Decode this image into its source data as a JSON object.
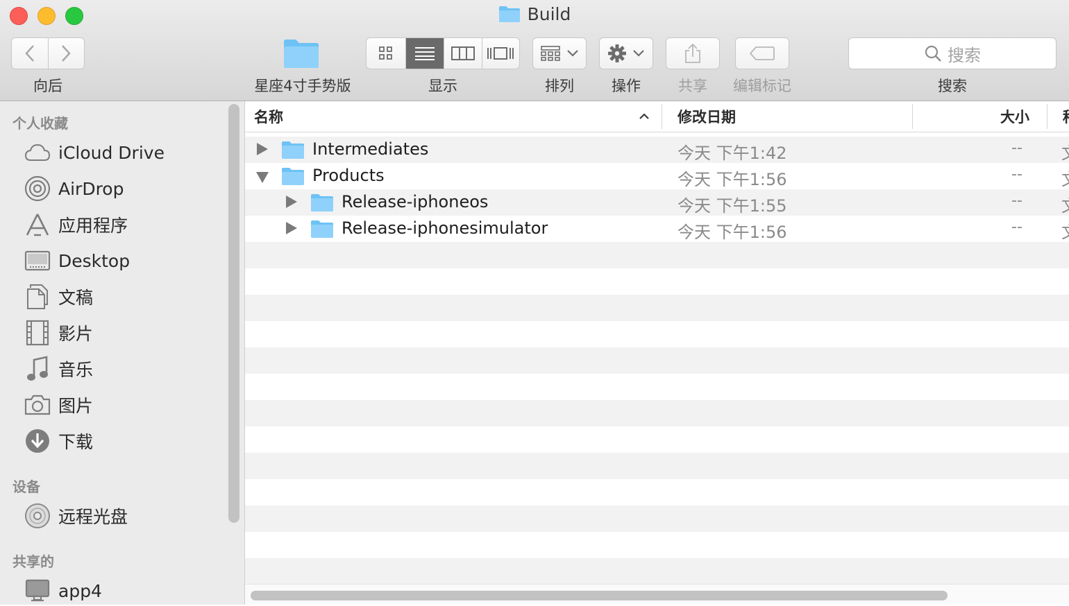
{
  "window": {
    "title": "Build"
  },
  "toolbar": {
    "back_label": "向后",
    "path_label": "星座4寸手势版",
    "view_label": "显示",
    "arrange_label": "排列",
    "action_label": "操作",
    "share_label": "共享",
    "tags_label": "编辑标记",
    "search_label": "搜索",
    "search_placeholder": "搜索",
    "active_view": "list"
  },
  "sidebar": {
    "favorites_header": "个人收藏",
    "favorites": [
      {
        "label": "iCloud Drive",
        "icon": "cloud-icon"
      },
      {
        "label": "AirDrop",
        "icon": "airdrop-icon"
      },
      {
        "label": "应用程序",
        "icon": "applications-icon"
      },
      {
        "label": "Desktop",
        "icon": "desktop-icon"
      },
      {
        "label": "文稿",
        "icon": "documents-icon"
      },
      {
        "label": "影片",
        "icon": "movies-icon"
      },
      {
        "label": "音乐",
        "icon": "music-icon"
      },
      {
        "label": "图片",
        "icon": "camera-icon"
      },
      {
        "label": "下载",
        "icon": "download-icon"
      }
    ],
    "devices_header": "设备",
    "devices": [
      {
        "label": "远程光盘",
        "icon": "disc-icon"
      }
    ],
    "shared_header": "共享的",
    "shared": [
      {
        "label": "app4",
        "icon": "computer-icon"
      }
    ]
  },
  "columns": {
    "name": "名称",
    "date": "修改日期",
    "size": "大小",
    "kind": "种"
  },
  "files": [
    {
      "name": "Intermediates",
      "date": "今天 下午1:42",
      "size": "--",
      "kind": "文",
      "expanded": false,
      "indent": 0
    },
    {
      "name": "Products",
      "date": "今天 下午1:56",
      "size": "--",
      "kind": "文",
      "expanded": true,
      "indent": 0
    },
    {
      "name": "Release-iphoneos",
      "date": "今天 下午1:55",
      "size": "--",
      "kind": "文",
      "expanded": false,
      "indent": 1
    },
    {
      "name": "Release-iphonesimulator",
      "date": "今天 下午1:56",
      "size": "--",
      "kind": "文",
      "expanded": false,
      "indent": 1
    }
  ],
  "colors": {
    "folder": "#6ec2f5",
    "close": "#fc5f57",
    "minimize": "#fdbc2e",
    "maximize": "#28c840"
  }
}
